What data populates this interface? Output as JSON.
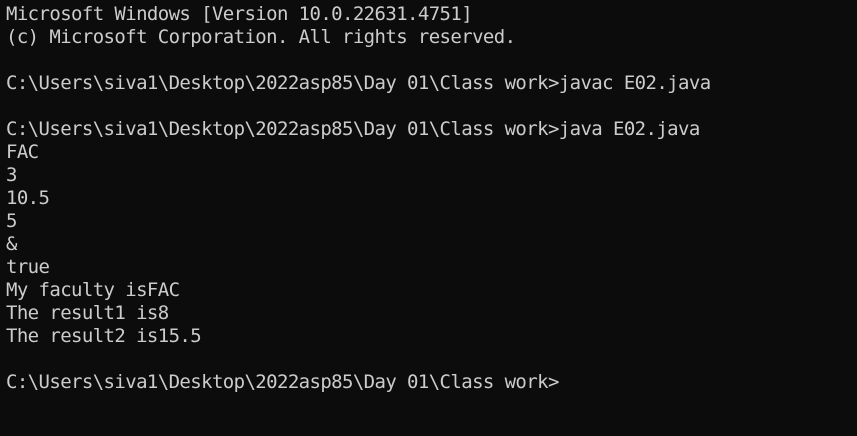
{
  "terminal": {
    "lines": [
      "Microsoft Windows [Version 10.0.22631.4751]",
      "(c) Microsoft Corporation. All rights reserved.",
      "",
      "C:\\Users\\siva1\\Desktop\\2022asp85\\Day 01\\Class work>javac E02.java",
      "",
      "C:\\Users\\siva1\\Desktop\\2022asp85\\Day 01\\Class work>java E02.java",
      "FAC",
      "3",
      "10.5",
      "5",
      "&",
      "true",
      "My faculty isFAC",
      "The result1 is8",
      "The result2 is15.5",
      "",
      "C:\\Users\\siva1\\Desktop\\2022asp85\\Day 01\\Class work>"
    ],
    "colors": {
      "background": "#0c0c0c",
      "text": "#cccccc"
    }
  }
}
